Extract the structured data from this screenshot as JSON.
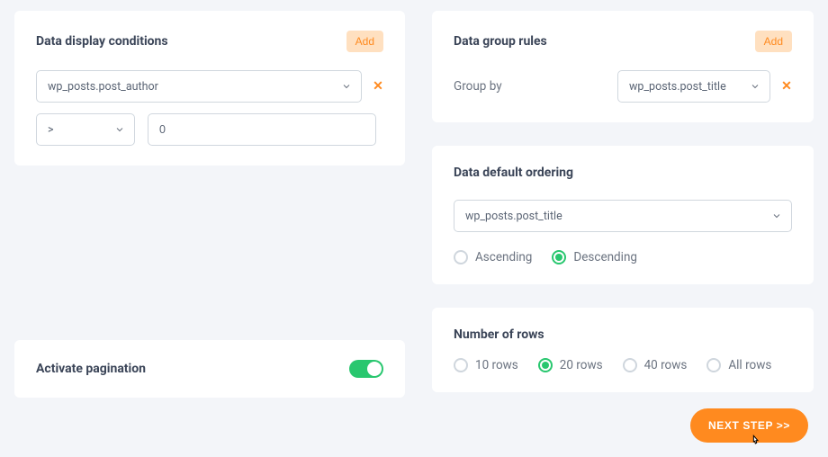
{
  "conditions": {
    "title": "Data display conditions",
    "add_label": "Add",
    "field": "wp_posts.post_author",
    "operator": ">",
    "value": "0"
  },
  "group_rules": {
    "title": "Data group rules",
    "add_label": "Add",
    "groupby_label": "Group by",
    "field": "wp_posts.post_title"
  },
  "ordering": {
    "title": "Data default ordering",
    "field": "wp_posts.post_title",
    "asc_label": "Ascending",
    "desc_label": "Descending",
    "selected": "desc"
  },
  "pagination": {
    "title": "Activate pagination",
    "on": true
  },
  "rows": {
    "title": "Number of rows",
    "options": {
      "r10": "10 rows",
      "r20": "20 rows",
      "r40": "40 rows",
      "rall": "All rows"
    },
    "selected": "r20"
  },
  "footer": {
    "next_label": "NEXT STEP >>"
  }
}
